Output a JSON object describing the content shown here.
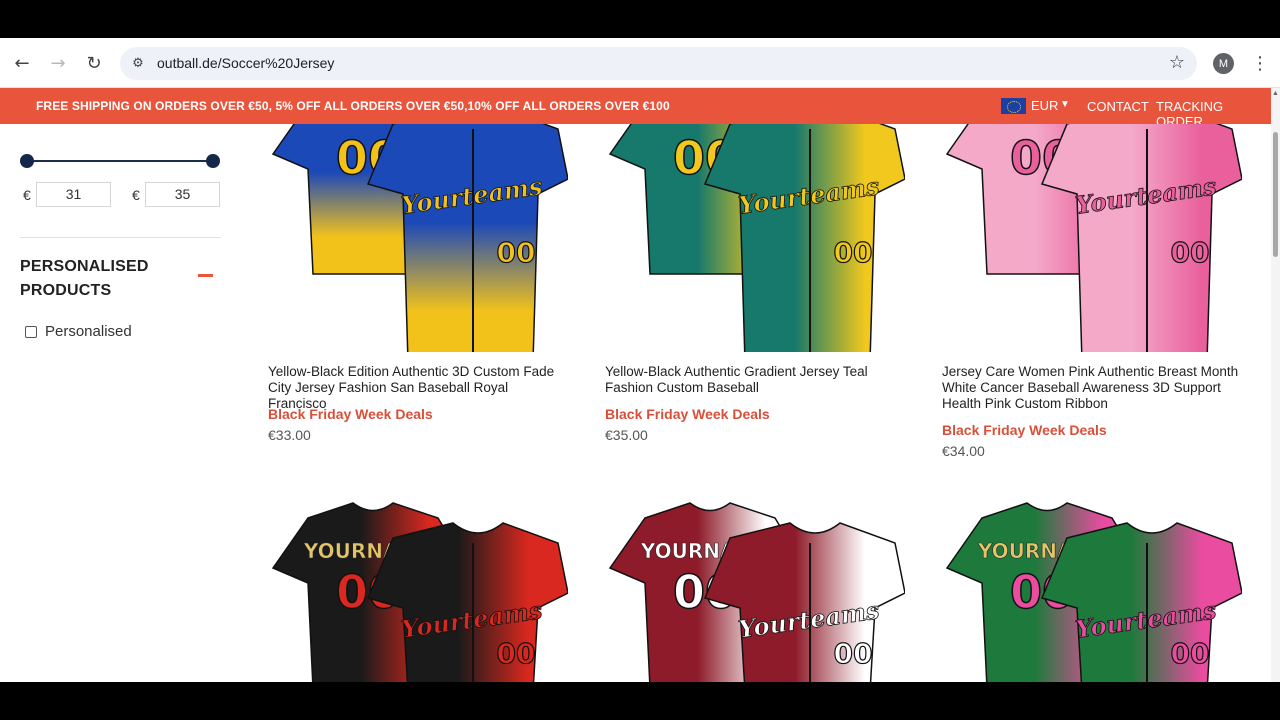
{
  "browser": {
    "url": "outball.de/Soccer%20Jersey",
    "profile_initial": "M"
  },
  "promo": {
    "text": "FREE SHIPPING ON ORDERS OVER €50, 5% OFF ALL ORDERS OVER €50,10% OFF ALL ORDERS OVER €100",
    "currency": "EUR",
    "contact": "CONTACT",
    "tracking": "TRACKING ORDER"
  },
  "sidebar": {
    "price_filter": {
      "currency_symbol": "€",
      "min_value": "31",
      "max_value": "35"
    },
    "personalised_section": {
      "title": "PERSONALISED PRODUCTS",
      "option_label": "Personalised"
    }
  },
  "products": [
    {
      "title": "Yellow-Black Edition Authentic 3D Custom Fade City Jersey Fashion San Baseball Royal Francisco",
      "deal": "Black Friday Week Deals",
      "price": "€33.00",
      "colors": [
        "#1c49b8",
        "#f2c21a"
      ]
    },
    {
      "title": "Yellow-Black Authentic Gradient Jersey Teal Fashion Custom Baseball",
      "deal": "Black Friday Week Deals",
      "price": "€35.00",
      "colors": [
        "#17796b",
        "#f0c81e"
      ]
    },
    {
      "title": "Jersey Care Women Pink Authentic Breast Month White Cancer Baseball Awareness 3D Support Health Pink Custom Ribbon",
      "deal": "Black Friday Week Deals",
      "price": "€34.00",
      "colors": [
        "#f4a9c9",
        "#e9609d"
      ]
    },
    {
      "title": "",
      "deal": "",
      "price": "",
      "colors": [
        "#1a1a1a",
        "#d8281f"
      ]
    },
    {
      "title": "",
      "deal": "",
      "price": "",
      "colors": [
        "#8e1b2a",
        "#ffffff"
      ]
    },
    {
      "title": "",
      "deal": "",
      "price": "",
      "colors": [
        "#1e7a3c",
        "#ea4ca0"
      ]
    }
  ],
  "jersey_text": {
    "script": "Yourteams",
    "number": "00",
    "name": "YOURNAME"
  },
  "theme": {
    "accent": "#e8543c",
    "navy": "#13284a"
  }
}
